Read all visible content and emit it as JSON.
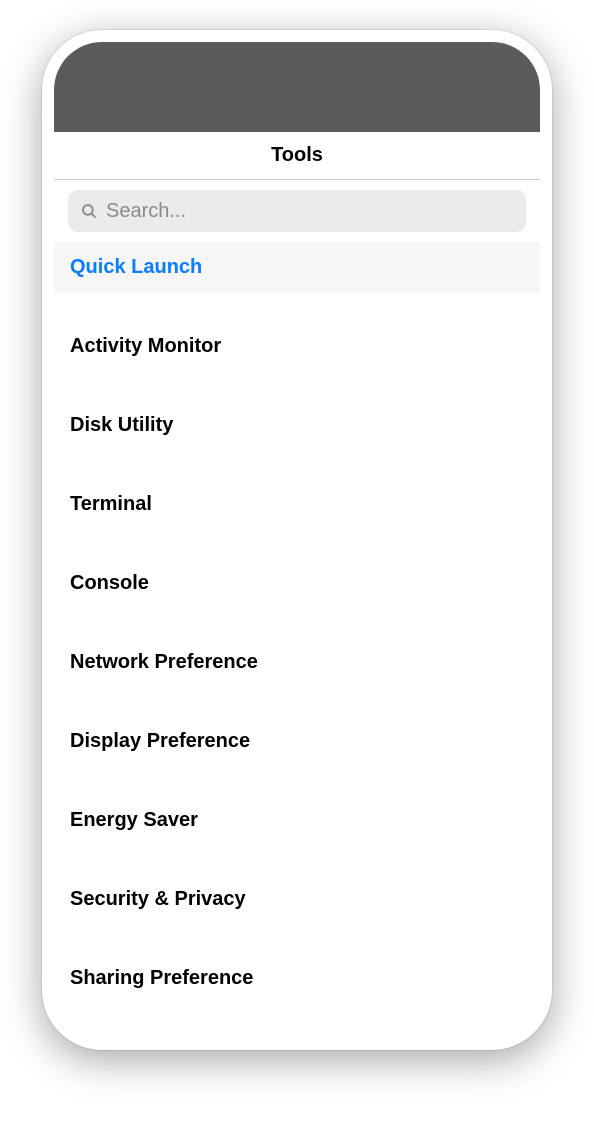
{
  "header": {
    "title": "Tools"
  },
  "search": {
    "placeholder": "Search...",
    "value": ""
  },
  "list": {
    "selected_index": 0,
    "items": [
      {
        "label": "Quick Launch"
      },
      {
        "label": "Activity Monitor"
      },
      {
        "label": "Disk Utility"
      },
      {
        "label": "Terminal"
      },
      {
        "label": "Console"
      },
      {
        "label": "Network Preference"
      },
      {
        "label": "Display Preference"
      },
      {
        "label": "Energy Saver"
      },
      {
        "label": "Security & Privacy"
      },
      {
        "label": "Sharing Preference"
      }
    ]
  },
  "colors": {
    "accent": "#0a7cff",
    "status_bar": "#5b5b5b",
    "search_bg": "#eceaea",
    "selected_bg": "#f6f6f8"
  }
}
